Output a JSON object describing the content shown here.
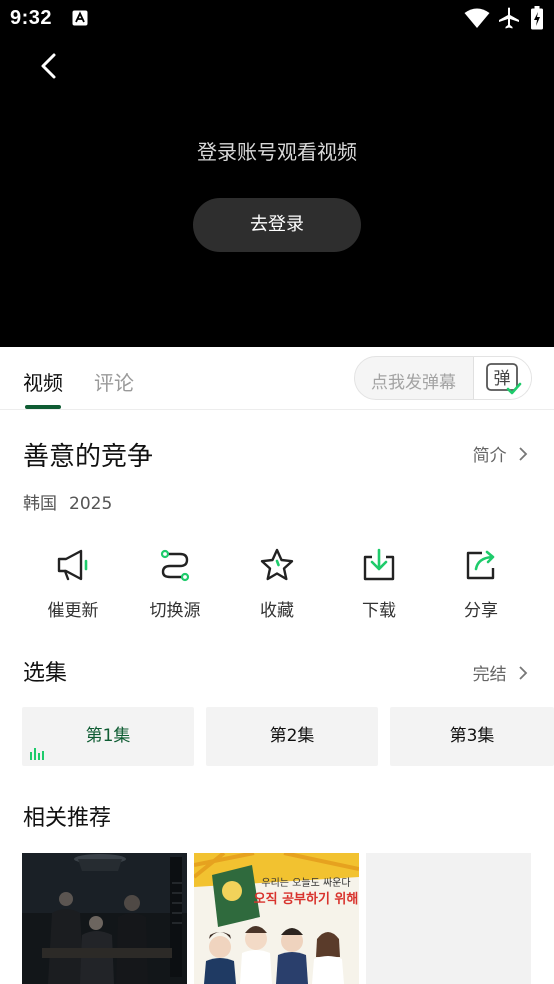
{
  "status_bar": {
    "time": "9:32",
    "icons": [
      "text-badge-icon",
      "wifi-icon",
      "airplane-icon",
      "battery-charging-icon"
    ]
  },
  "player": {
    "login_message": "登录账号观看视频",
    "login_button": "去登录"
  },
  "tabs": [
    {
      "label": "视频",
      "active": true
    },
    {
      "label": "评论",
      "active": false
    }
  ],
  "danmaku": {
    "placeholder": "点我发弹幕",
    "button_label": "弹"
  },
  "show": {
    "title": "善意的竞争",
    "intro_label": "简介",
    "country": "韩国",
    "year": "2025"
  },
  "actions": [
    {
      "label": "催更新",
      "icon": "megaphone-icon"
    },
    {
      "label": "切换源",
      "icon": "switch-source-icon"
    },
    {
      "label": "收藏",
      "icon": "star-icon"
    },
    {
      "label": "下载",
      "icon": "download-icon"
    },
    {
      "label": "分享",
      "icon": "share-icon"
    }
  ],
  "episodes": {
    "title": "选集",
    "status": "完结",
    "items": [
      {
        "label": "第1集",
        "playing": true
      },
      {
        "label": "第2集",
        "playing": false
      },
      {
        "label": "第3集",
        "playing": false
      }
    ]
  },
  "recommendations": {
    "title": "相关推荐",
    "poster_texts": [
      "우리는 오늘도 싸운다",
      "오직 공부하기 위해"
    ]
  },
  "colors": {
    "accent": "#0f5c33",
    "highlight": "#1ecb6b",
    "video_bg": "#000000"
  }
}
